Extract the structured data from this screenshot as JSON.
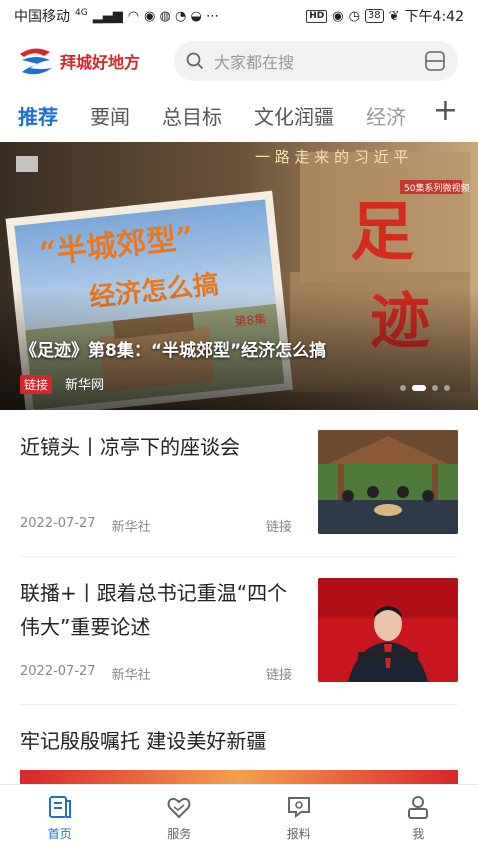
{
  "status_bar": {
    "carrier": "中国移动",
    "network": "4G",
    "battery": "38",
    "time": "下午4:42"
  },
  "header": {
    "app_name": "拜城好地方",
    "search_placeholder": "大家都在搜"
  },
  "tabs": [
    {
      "label": "推荐",
      "active": true
    },
    {
      "label": "要闻"
    },
    {
      "label": "总目标"
    },
    {
      "label": "文化润疆"
    },
    {
      "label": "经济"
    }
  ],
  "banner": {
    "caption": "《足迹》第8集：“半城郊型”经济怎么搞",
    "tag": "链接",
    "source": "新华网",
    "poster_title": "“半城郊型”",
    "poster_subtitle": "经济怎么搞",
    "poster_episode": "第8集",
    "poster_top": "一路走来的习近平",
    "poster_big": "足迹",
    "poster_badge": "50集系列微视频"
  },
  "news": [
    {
      "title": "近镜头丨凉亭下的座谈会",
      "date": "2022-07-27",
      "source": "新华社",
      "type": "链接"
    },
    {
      "title": "联播+丨跟着总书记重温“四个伟大”重要论述",
      "date": "2022-07-27",
      "source": "新华社",
      "type": "链接"
    },
    {
      "title": "牢记殷殷嘱托 建设美好新疆"
    }
  ],
  "bottom_nav": [
    {
      "label": "首页",
      "active": true
    },
    {
      "label": "服务"
    },
    {
      "label": "报料"
    },
    {
      "label": "我"
    }
  ],
  "colors": {
    "accent": "#1e6fd0",
    "brand_red": "#d9262b"
  }
}
